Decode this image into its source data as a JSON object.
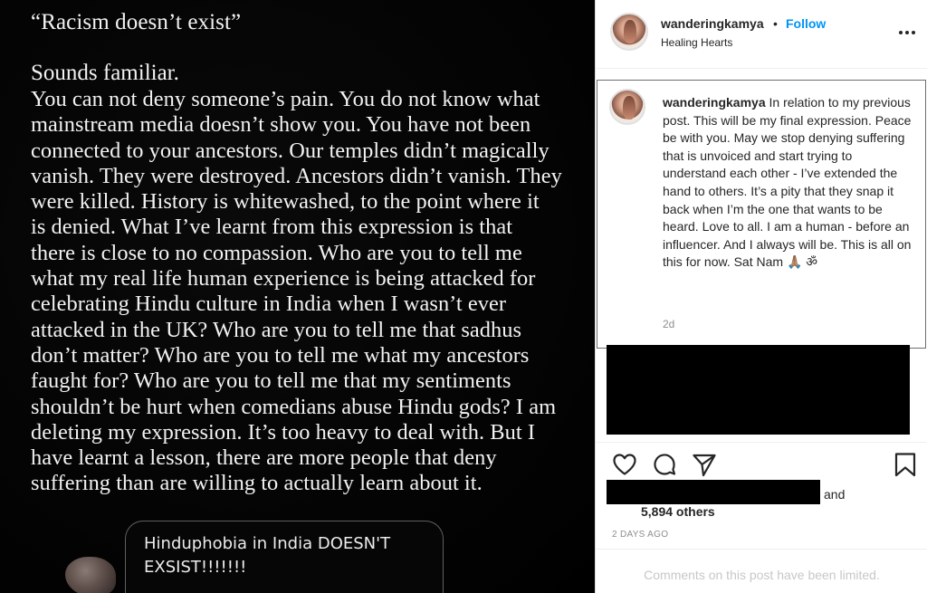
{
  "post_image": {
    "quote_title": "“Racism doesn’t exist”",
    "lead": "Sounds familiar.",
    "body_lines": [
      "You can not deny someone’s pain. You do not know what",
      "mainstream media doesn’t show you. You have not been",
      "connected to your ancestors. Our temples didn’t magically",
      "vanish. They were destroyed. Ancestors didn’t vanish. They",
      "were killed. History is whitewashed, to the point where it",
      "is denied. What I’ve learnt from this expression is that",
      "there is close to no compassion. Who are you to tell me",
      "what my real life human experience is being attacked for",
      "celebrating Hindu culture in India when I wasn’t ever",
      "attacked in the UK? Who are you to tell me that sadhus",
      "don’t matter? Who are you to tell me what my ancestors",
      "faught for? Who are you to tell me that my sentiments",
      "shouldn’t be hurt when comedians abuse Hindu gods? I am",
      "deleting my expression. It’s too heavy to deal with. But I",
      "have learnt a lesson, there are more people that deny",
      "suffering than are willing to actually learn about it."
    ],
    "sticker_text": "Hinduphobia in India DOESN'T EXSIST!!!!!!!"
  },
  "header": {
    "username": "wanderingkamya",
    "separator": "•",
    "follow_label": "Follow",
    "location": "Healing Hearts",
    "more_icon": "more-options-icon"
  },
  "caption": {
    "username": "wanderingkamya",
    "text": "In relation to my previous post. This will be my final expression. Peace be with you. May we stop denying suffering that is unvoiced and start trying to understand each other - I’ve extended the hand to others. It’s a pity that they snap it back when I’m the one that wants to be heard. Love to all. I am a human - before an influencer. And I always will be. This is all on this for now. Sat Nam 🙏🏽 ॐ",
    "time": "2d"
  },
  "actions": {
    "like_icon": "heart-icon",
    "comment_icon": "comment-icon",
    "share_icon": "share-icon",
    "save_icon": "bookmark-icon"
  },
  "likes": {
    "and": "and",
    "others": "5,894 others"
  },
  "post_date": "2 DAYS AGO",
  "comments_notice": "Comments on this post have been limited."
}
